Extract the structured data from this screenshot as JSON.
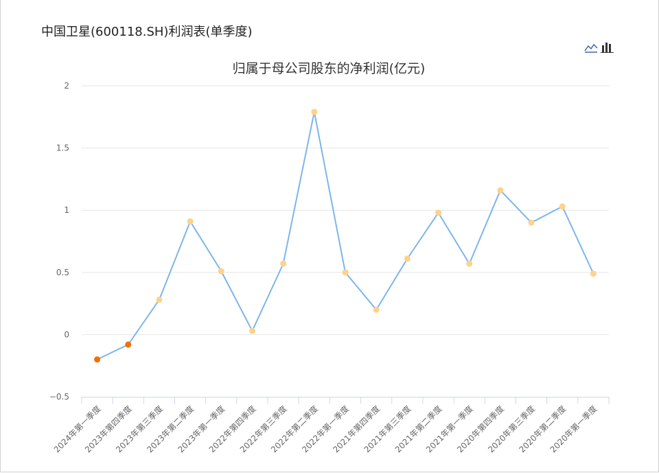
{
  "page": {
    "title": "中国卫星(600118.SH)利润表(单季度)"
  },
  "toolbar": {
    "icons": [
      "line-chart-icon",
      "bar-chart-icon"
    ]
  },
  "colors": {
    "line": "#7cb5ec",
    "marker": "#ffd28a",
    "marker_negative": "#f07000",
    "grid": "#e6e6e6",
    "axis": "#ccd6eb",
    "text": "#333333",
    "tick": "#666666"
  },
  "chart_data": {
    "type": "line",
    "title": "归属于母公司股东的净利润(亿元)",
    "categories": [
      "2024年第一季度",
      "2023年第四季度",
      "2023年第三季度",
      "2023年第二季度",
      "2023年第一季度",
      "2022年第四季度",
      "2022年第三季度",
      "2022年第二季度",
      "2022年第一季度",
      "2021年第四季度",
      "2021年第三季度",
      "2021年第二季度",
      "2021年第一季度",
      "2020年第四季度",
      "2020年第三季度",
      "2020年第二季度",
      "2020年第一季度"
    ],
    "series": [
      {
        "values": [
          -0.2,
          -0.08,
          0.28,
          0.91,
          0.51,
          0.03,
          0.57,
          1.79,
          0.5,
          0.2,
          0.61,
          0.98,
          0.57,
          1.16,
          0.9,
          1.03,
          0.49
        ]
      }
    ],
    "yticks": [
      "2",
      "1.5",
      "1",
      "0.5",
      "0",
      "−0.5"
    ],
    "ylim": [
      -0.5,
      2
    ],
    "grid": true,
    "legend": "none"
  }
}
